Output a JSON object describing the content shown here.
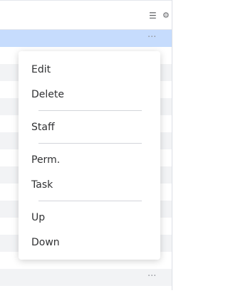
{
  "toolbar": {
    "icons": [
      "list-icon",
      "gear-icon"
    ]
  },
  "rows": {
    "more_label": "···"
  },
  "menu": {
    "items": [
      "Edit",
      "Delete",
      "Staff",
      "Perm.",
      "Task",
      "Up",
      "Down"
    ]
  },
  "colors": {
    "selected_row": "#c6dcfd",
    "stripe_row": "#f2f3f5",
    "menu_bg": "#ffffff"
  }
}
